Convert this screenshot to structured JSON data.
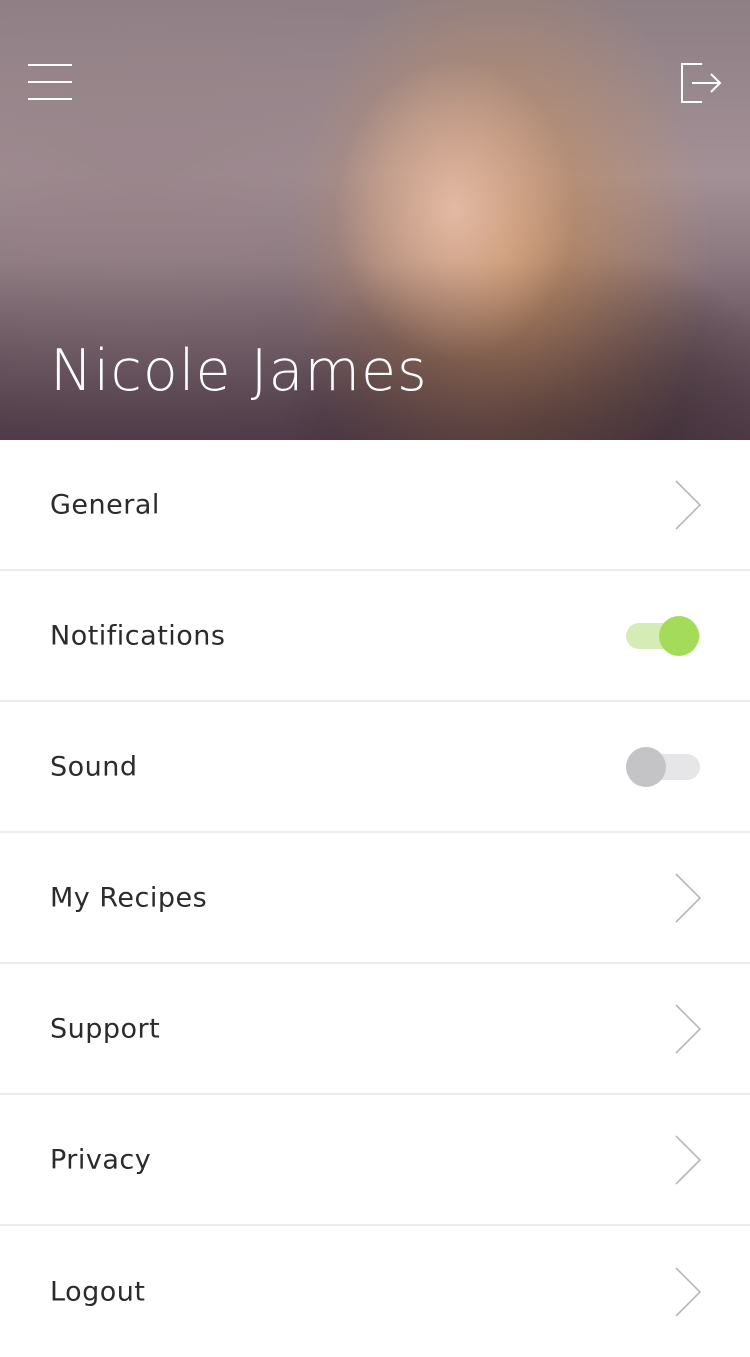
{
  "header": {
    "user_name": "Nicole James",
    "menu_icon": "hamburger-menu-icon",
    "exit_icon": "exit-icon"
  },
  "settings": {
    "general_label": "General",
    "notifications_label": "Notifications",
    "notifications_on": true,
    "sound_label": "Sound",
    "sound_on": false,
    "my_recipes_label": "My Recipes",
    "support_label": "Support",
    "privacy_label": "Privacy",
    "logout_label": "Logout"
  },
  "colors": {
    "toggle_on_knob": "#a4dc5a",
    "toggle_on_track": "#d5ecb6",
    "toggle_off_knob": "#c4c4c7",
    "toggle_off_track": "#e6e6e8",
    "divider": "#ececec",
    "chevron": "#b8b8b8"
  }
}
